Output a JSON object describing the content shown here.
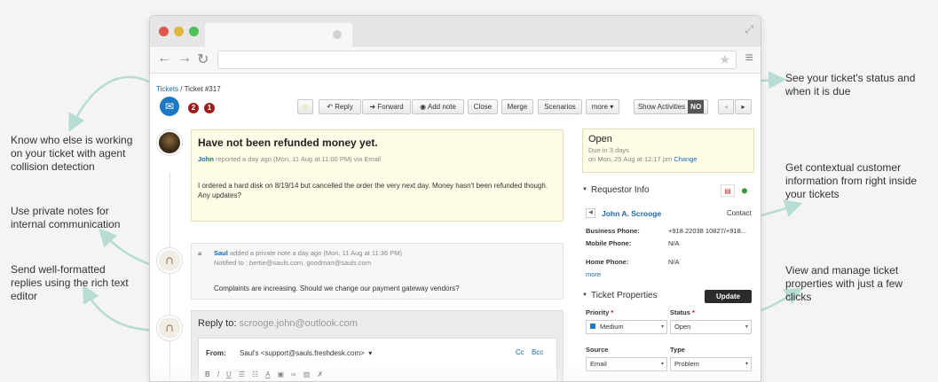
{
  "callouts": {
    "status": "See your ticket's status and when it is due",
    "collision": "Know who else is working on your ticket with agent collision detection",
    "contextual": "Get contextual customer information from right inside your tickets",
    "private_notes": "Use private notes for internal communication",
    "manage": "View and manage ticket properties with just a few clicks",
    "replies": "Send well-formatted replies using the rich text editor"
  },
  "breadcrumb": {
    "root": "Tickets",
    "sep": " / ",
    "current": "Ticket #317"
  },
  "badges": {
    "first": "2",
    "second": "1"
  },
  "toolbar": {
    "reply": "Reply",
    "forward": "Forward",
    "add_note": "Add note",
    "close": "Close",
    "merge": "Merge",
    "scenarios": "Scenarios",
    "more": "more",
    "show_activities": "Show Activities",
    "toggle": "NO"
  },
  "ticket": {
    "subject": "Have not been refunded money yet.",
    "author": "John",
    "meta": " reported a day ago (Mon, 11 Aug at 11:00 PM) via Email",
    "body": "I ordered a hard disk on 8/19/14 but cancelled the order the very next day. Money hasn't been refunded though. Any updates?"
  },
  "note": {
    "author": "Saul",
    "meta": " added a private note a day ago (Mon, 11 Aug at 11:36 PM)",
    "notified": "Notified to : bertie@sauls.com, goodman@sauls.com",
    "body": "Complaints are increasing. Should we change our payment gateway vendors?"
  },
  "reply": {
    "label": "Reply to:",
    "address": " scrooge.john@outlook.com",
    "from_label": "From:",
    "from_value": "Saul's <support@sauls.freshdesk.com>",
    "cc": "Cc",
    "bcc": "Bcc"
  },
  "status": {
    "value": "Open",
    "due": "Due in 3 days",
    "date": "on Mon, 25 Aug at 12:17 pm",
    "change": "Change"
  },
  "requestor": {
    "heading": "Requestor Info",
    "name": "John A. Scrooge",
    "type": "Contact",
    "business_label": "Business Phone:",
    "business_value": "+918 22038 10827/+918...",
    "mobile_label": "Mobile Phone:",
    "mobile_value": "N/A",
    "home_label": "Home Phone:",
    "home_value": "N/A",
    "more": "more"
  },
  "properties": {
    "heading": "Ticket Properties",
    "update": "Update",
    "priority_label": "Priority",
    "priority_value": "Medium",
    "status_label": "Status",
    "status_value": "Open",
    "source_label": "Source",
    "source_value": "Email",
    "type_label": "Type",
    "type_value": "Problem"
  },
  "colors": {
    "accent": "#1d78c6",
    "badge": "#9c1c1c",
    "note_yellow": "#fefbe6",
    "arrow": "#b6dcd3"
  }
}
